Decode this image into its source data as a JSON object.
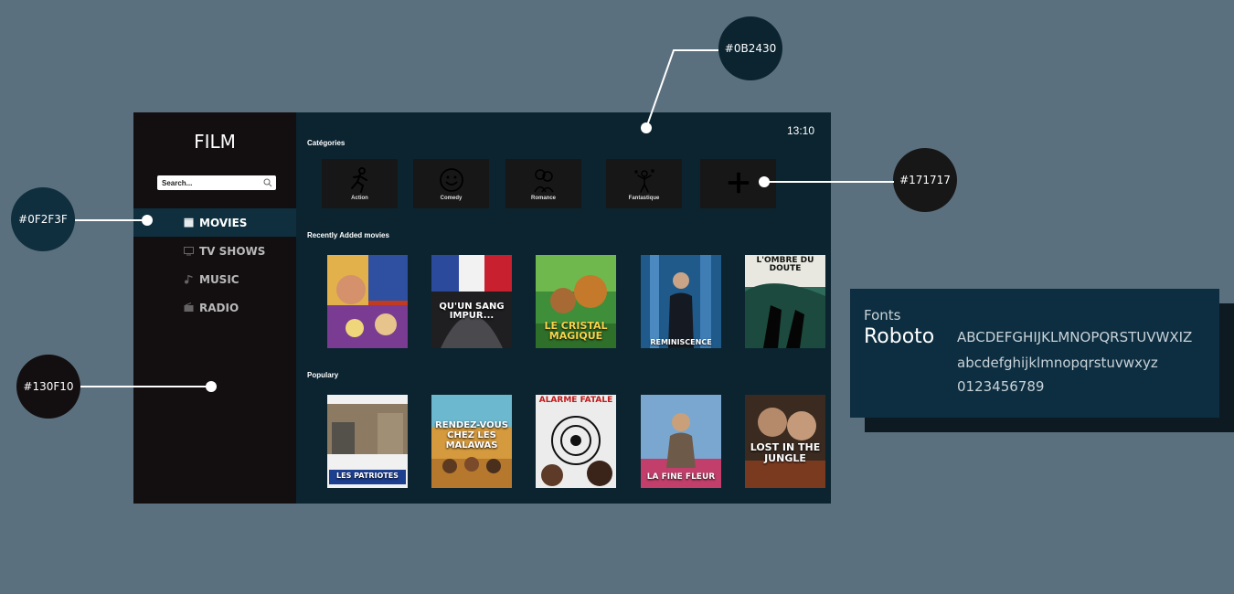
{
  "app": {
    "logo": "FILM",
    "search_placeholder": "Search...",
    "clock": "13:10",
    "nav": [
      {
        "label": "MOVIES",
        "icon": "clapperboard-icon",
        "active": true
      },
      {
        "label": "TV SHOWS",
        "icon": "tv-icon",
        "active": false
      },
      {
        "label": "MUSIC",
        "icon": "music-note-icon",
        "active": false
      },
      {
        "label": "RADIO",
        "icon": "radio-icon",
        "active": false
      }
    ],
    "categories_title": "Catégories",
    "categories": [
      {
        "label": "Action",
        "icon": "running-man-icon"
      },
      {
        "label": "Comedy",
        "icon": "smiley-face-icon"
      },
      {
        "label": "Romance",
        "icon": "couple-icon"
      },
      {
        "label": "Fantastique",
        "icon": "sparkle-figure-icon"
      },
      {
        "label": "",
        "icon": "plus-icon"
      }
    ],
    "recent_title": "Recently Added movies",
    "recent": [
      {
        "title": "",
        "poster_color": "#c23a1f"
      },
      {
        "title": "QU'UN SANG IMPUR...",
        "poster_color": "#2a2a2e"
      },
      {
        "title": "LE CRISTAL MAGIQUE",
        "poster_color": "#d48a2a"
      },
      {
        "title": "REMINISCENCE",
        "poster_color": "#1f5a8a"
      },
      {
        "title": "L'OMBRE DU DOUTE",
        "poster_color": "#2f6b5a"
      }
    ],
    "popular_title": "Populary",
    "popular": [
      {
        "title": "LES PATRIOTES",
        "poster_color": "#f1f1f1"
      },
      {
        "title": "RENDEZ-VOUS CHEZ LES MALAWAS",
        "poster_color": "#d59a3d"
      },
      {
        "title": "ALARME FATALE",
        "poster_color": "#ececec"
      },
      {
        "title": "LA FINE FLEUR",
        "poster_color": "#7aa7d0"
      },
      {
        "title": "LOST IN THE JUNGLE",
        "poster_color": "#3a2a1f"
      }
    ]
  },
  "annotations": {
    "main_bg": "#0B2430",
    "card_bg": "#171717",
    "active_item": "#0F2F3F",
    "sidebar_bg": "#130F10"
  },
  "fonts_card": {
    "label": "Fonts",
    "name": "Roboto",
    "uppercase": "ABCDEFGHIJKLMNOPQRSTUVWXIZ",
    "lowercase": "abcdefghijklmnopqrstuvwxyz",
    "digits": "0123456789"
  }
}
